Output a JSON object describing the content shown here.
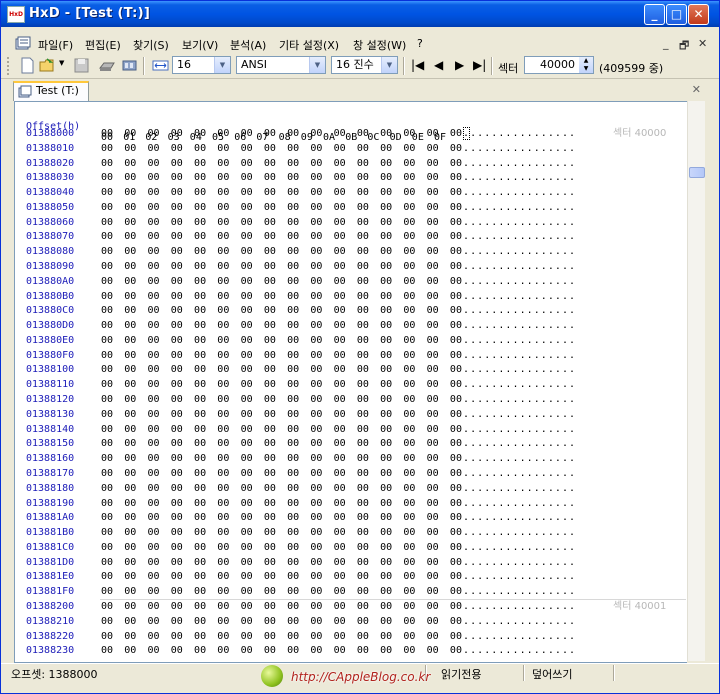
{
  "window": {
    "app_icon": "HxD",
    "title": "HxD - [Test (T:)]",
    "minimize": "_",
    "maximize": "□",
    "close": "✕"
  },
  "menu": {
    "items": [
      "파일(F)",
      "편집(E)",
      "찾기(S)",
      "보기(V)",
      "분석(A)",
      "기타 설정(X)",
      "창 설정(W)",
      "?"
    ],
    "mdi_minimize": "_",
    "mdi_restore": "🗗",
    "mdi_close": "✕"
  },
  "toolbar": {
    "bytes_per_row": "16",
    "charset": "ANSI",
    "offset_base": "16 진수",
    "sector_label": "섹터",
    "sector_value": "40000",
    "sector_total": "(409599 중)"
  },
  "tabs": [
    {
      "label": "Test (T:)"
    }
  ],
  "tab_close": "✕",
  "editor": {
    "header_offset": "Offset(h)",
    "header_columns": [
      "00",
      "01",
      "02",
      "03",
      "04",
      "05",
      "06",
      "07",
      "08",
      "09",
      "0A",
      "0B",
      "0C",
      "0D",
      "0E",
      "0F"
    ],
    "rows": [
      {
        "offset": "01388000"
      },
      {
        "offset": "01388010"
      },
      {
        "offset": "01388020"
      },
      {
        "offset": "01388030"
      },
      {
        "offset": "01388040"
      },
      {
        "offset": "01388050"
      },
      {
        "offset": "01388060"
      },
      {
        "offset": "01388070"
      },
      {
        "offset": "01388080"
      },
      {
        "offset": "01388090"
      },
      {
        "offset": "013880A0"
      },
      {
        "offset": "013880B0"
      },
      {
        "offset": "013880C0"
      },
      {
        "offset": "013880D0"
      },
      {
        "offset": "013880E0"
      },
      {
        "offset": "013880F0"
      },
      {
        "offset": "01388100"
      },
      {
        "offset": "01388110"
      },
      {
        "offset": "01388120"
      },
      {
        "offset": "01388130"
      },
      {
        "offset": "01388140"
      },
      {
        "offset": "01388150"
      },
      {
        "offset": "01388160"
      },
      {
        "offset": "01388170"
      },
      {
        "offset": "01388180"
      },
      {
        "offset": "01388190"
      },
      {
        "offset": "013881A0"
      },
      {
        "offset": "013881B0"
      },
      {
        "offset": "013881C0"
      },
      {
        "offset": "013881D0"
      },
      {
        "offset": "013881E0"
      },
      {
        "offset": "013881F0"
      },
      {
        "offset": "01388200"
      },
      {
        "offset": "01388210"
      },
      {
        "offset": "01388220"
      },
      {
        "offset": "01388230"
      }
    ],
    "hex_values": "00 00 00 00 00 00 00 00 00 00 00 00 00 00 00 00",
    "ascii_values": "................",
    "sector_notes": [
      {
        "row": 0,
        "text": "섹터 40000"
      },
      {
        "row": 32,
        "text": "섹터 40001"
      }
    ]
  },
  "status": {
    "offset": "오프셋: 1388000",
    "mode": "읽기전용",
    "write_mode": "덮어쓰기"
  },
  "watermark": "http://CAppleBlog.co.kr",
  "colors": {
    "titlebar": "#0054e3",
    "offset_text": "#1c1cb8",
    "sector_note": "#b7b7b7"
  }
}
